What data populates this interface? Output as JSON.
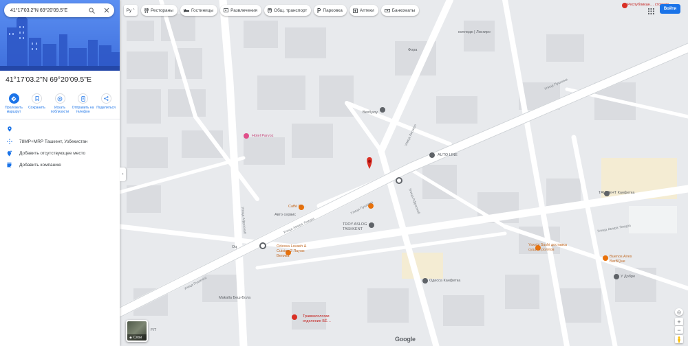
{
  "search": {
    "value": "41°17'03.2\"N 69°20'09.5\"E"
  },
  "place": {
    "title": "41°17'03.2\"N 69°20'09.5\"E"
  },
  "actions": [
    {
      "label": "Проложить маршрут",
      "icon": "directions-icon"
    },
    {
      "label": "Сохранить",
      "icon": "bookmark-icon"
    },
    {
      "label": "Искать поблизости",
      "icon": "nearby-icon"
    },
    {
      "label": "Отправить на телефон",
      "icon": "phone-icon"
    },
    {
      "label": "Поделиться",
      "icon": "share-icon"
    }
  ],
  "info": [
    {
      "text": "",
      "icon": "location-pin-icon"
    },
    {
      "text": "78MP+MRP Ташкент, Узбекистан",
      "icon": "plus-code-icon"
    },
    {
      "text": "Добавить отсутствующее место",
      "icon": "add-place-icon"
    },
    {
      "text": "Добавить компанию",
      "icon": "add-business-icon"
    }
  ],
  "chips": {
    "menu": "Ру",
    "items": [
      {
        "label": "Рестораны",
        "icon": "restaurant-icon"
      },
      {
        "label": "Гостиницы",
        "icon": "hotel-icon"
      },
      {
        "label": "Развлечения",
        "icon": "entertainment-icon"
      },
      {
        "label": "Общ. транспорт",
        "icon": "transit-icon"
      },
      {
        "label": "Парковка",
        "icon": "parking-icon"
      },
      {
        "label": "Аптеки",
        "icon": "pharmacy-icon"
      },
      {
        "label": "Банкоматы",
        "icon": "atm-icon"
      }
    ]
  },
  "header": {
    "signin": "Войти"
  },
  "map": {
    "pois": {
      "respublika": "Республикан… стомато…",
      "kolleji": "колледж | Лисгиро",
      "fora": "Фора",
      "hotel_parvoz": "Hotel Parvoz",
      "vehbuyu": "Вехбуюу",
      "auto_line": "AUTO LINE",
      "caffe": "Caffè Dr…",
      "auto_service": "Авто сервис",
      "troy": "TROY ASLOG TASHKENT",
      "odessa": "Odessa Lavash & Cuisine 2 Лаунж Велика",
      "tashkent_kanfetka": "ТАШКЕНТ Канфетка",
      "yaxshi_sushi": "Yaxshi Sushi доставка суши и роллов",
      "buenos": "Buenos Aires BarBQue",
      "v_dobre": "У Добре",
      "makalla": "Makalla Беш-Бола",
      "travma": "Травматологии отделение БЁ…",
      "odessa_kanfetka": "Одесса Канфетка",
      "fit": "FIT",
      "oq": "Oq"
    },
    "roads": {
      "pushkin_a": "Улица Пушкина",
      "pushkin_b": "Улица Пушкина",
      "pushkin_c": "Улица Пушкина",
      "amir_a": "Улица Амира Темура",
      "amir_b": "Улица Амира Темура",
      "lisgiro": "Улица Лисгиро",
      "side_a": "Улица Афросиаб",
      "side_b": "Улица Афросиаб"
    },
    "layers_label": "Слои",
    "google": "Google"
  },
  "colors": {
    "accent": "#1a73e8",
    "pin": "#d93025",
    "map_bg": "#e8eaed",
    "road": "#ffffff",
    "block": "#dadce0"
  }
}
